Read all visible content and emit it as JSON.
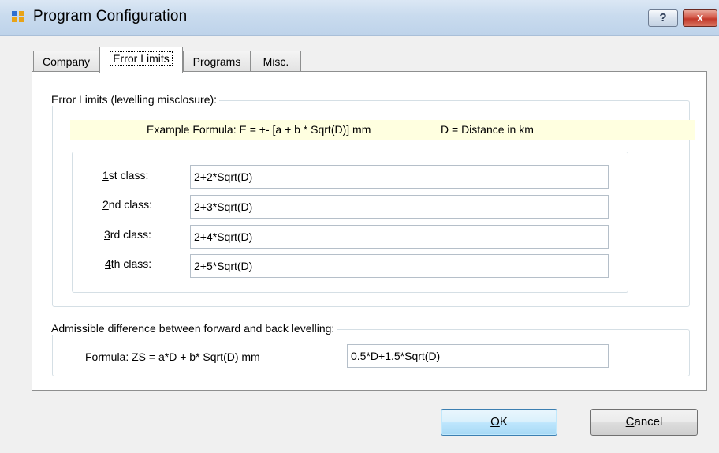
{
  "window": {
    "title": "Program Configuration",
    "help_label": "?",
    "close_label": "x"
  },
  "tabs": [
    {
      "label": "Company",
      "active": false
    },
    {
      "label": "Error Limits",
      "active": true
    },
    {
      "label": "Programs",
      "active": false
    },
    {
      "label": "Misc.",
      "active": false
    }
  ],
  "error_limits": {
    "group_label": "Error Limits (levelling misclosure):",
    "example_formula": "Example Formula:  E = +- [a + b * Sqrt(D)]  mm",
    "distance_note": "D = Distance in km",
    "rows": [
      {
        "mnemonic": "1",
        "label_rest": "st class:",
        "value": "2+2*Sqrt(D)"
      },
      {
        "mnemonic": "2",
        "label_rest": "nd class:",
        "value": "2+3*Sqrt(D)"
      },
      {
        "mnemonic": "3",
        "label_rest": "rd class:",
        "value": "2+4*Sqrt(D)"
      },
      {
        "mnemonic": "4",
        "label_rest": "th class:",
        "value": "2+5*Sqrt(D)"
      }
    ]
  },
  "admissible": {
    "group_label": "Admissible difference between forward and back levelling:",
    "formula_label": "Formula: ZS = a*D + b* Sqrt(D) mm",
    "value": "0.5*D+1.5*Sqrt(D)"
  },
  "buttons": {
    "ok_mnemonic": "O",
    "ok_rest": "K",
    "cancel_mnemonic": "C",
    "cancel_rest": "ancel"
  },
  "icons": {
    "app": "app-window-icon"
  },
  "colors": {
    "example_highlight": "#ffffe0",
    "close_button": "#c2392a",
    "default_button_border": "#3c7fb1"
  }
}
